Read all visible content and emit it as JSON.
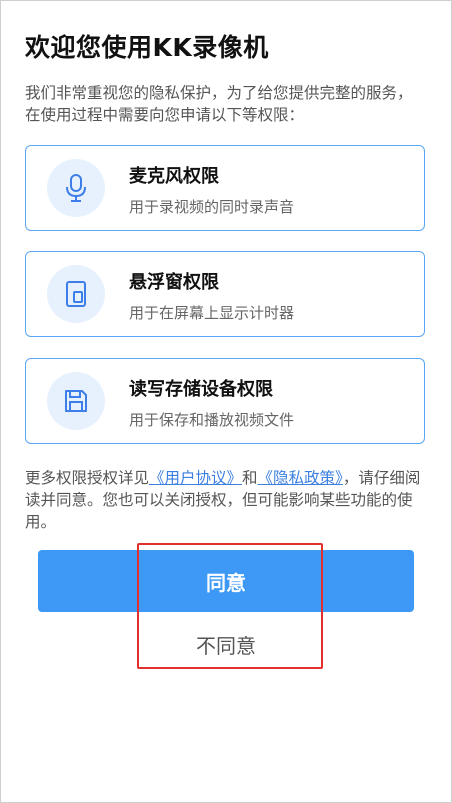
{
  "dialog": {
    "title": "欢迎您使用KK录像机",
    "intro": "我们非常重视您的隐私保护，为了给您提供完整的服务，在使用过程中需要向您申请以下等权限："
  },
  "permissions": [
    {
      "icon": "microphone-icon",
      "title": "麦克风权限",
      "desc": "用于录视频的同时录声音"
    },
    {
      "icon": "floating-window-icon",
      "title": "悬浮窗权限",
      "desc": "用于在屏幕上显示计时器"
    },
    {
      "icon": "save-disk-icon",
      "title": "读写存储设备权限",
      "desc": "用于保存和播放视频文件"
    }
  ],
  "footer": {
    "prefix": "更多权限授权详见",
    "user_agreement": "《用户协议》",
    "and": "和",
    "privacy_policy": "《隐私政策》",
    "suffix": "，请仔细阅读并同意。您也可以关闭授权，但可能影响某些功能的使用。"
  },
  "buttons": {
    "agree": "同意",
    "disagree": "不同意"
  },
  "colors": {
    "accent": "#3d99f5",
    "card_border": "#5aa6f2",
    "icon_bg": "#e7f1fd",
    "link": "#3b7fe0",
    "highlight": "#e0312f"
  }
}
